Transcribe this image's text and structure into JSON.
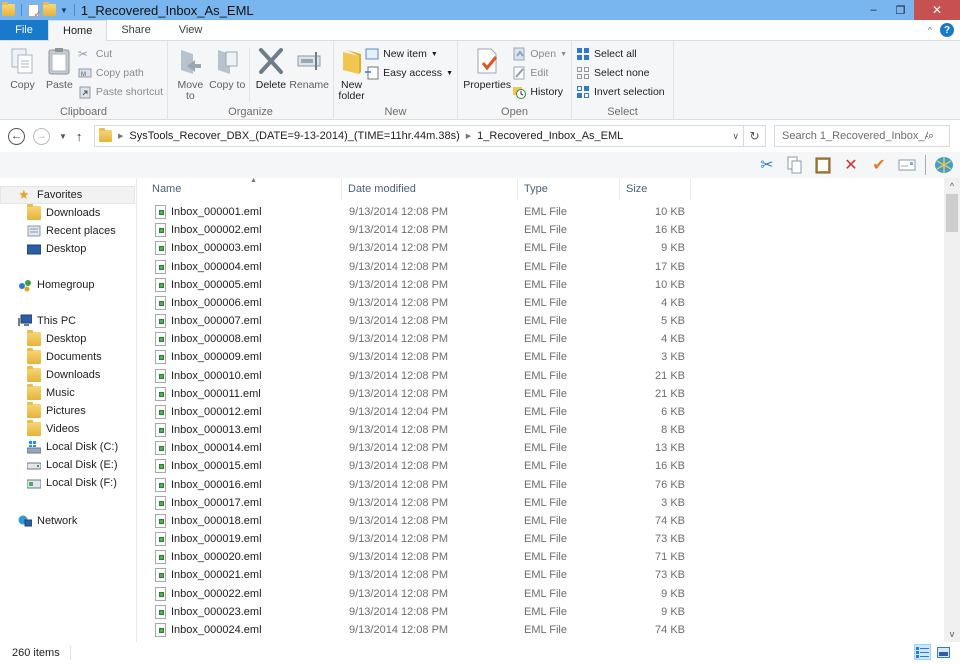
{
  "window": {
    "title": "1_Recovered_Inbox_As_EML",
    "minimize": "–",
    "restore": "❐",
    "close": "✕"
  },
  "ribbon_tabs": [
    {
      "label": "File"
    },
    {
      "label": "Home"
    },
    {
      "label": "Share"
    },
    {
      "label": "View"
    }
  ],
  "ribbon": {
    "clipboard": {
      "label": "Clipboard",
      "copy": "Copy",
      "paste": "Paste",
      "cut": "Cut",
      "copy_path": "Copy path",
      "paste_shortcut": "Paste shortcut"
    },
    "organize": {
      "label": "Organize",
      "move_to": "Move to",
      "copy_to": "Copy to",
      "delete": "Delete",
      "rename": "Rename"
    },
    "new": {
      "label": "New",
      "new_folder": "New folder",
      "new_item": "New item",
      "easy_access": "Easy access"
    },
    "open": {
      "label": "Open",
      "properties": "Properties",
      "open": "Open",
      "edit": "Edit",
      "history": "History"
    },
    "select": {
      "label": "Select",
      "select_all": "Select all",
      "select_none": "Select none",
      "invert_selection": "Invert selection"
    }
  },
  "address": {
    "crumbs": [
      "SysTools_Recover_DBX_(DATE=9-13-2014)_(TIME=11hr.44m.38s)",
      "1_Recovered_Inbox_As_EML"
    ],
    "search_placeholder": "Search 1_Recovered_Inbox_As..."
  },
  "sidebar": {
    "favorites": "Favorites",
    "favorites_items": [
      "Downloads",
      "Recent places",
      "Desktop"
    ],
    "homegroup": "Homegroup",
    "this_pc": "This PC",
    "this_pc_items": [
      "Desktop",
      "Documents",
      "Downloads",
      "Music",
      "Pictures",
      "Videos",
      "Local Disk (C:)",
      "Local Disk (E:)",
      "Local Disk (F:)"
    ],
    "network": "Network"
  },
  "columns": {
    "name": "Name",
    "date": "Date modified",
    "type": "Type",
    "size": "Size"
  },
  "files": [
    {
      "name": "Inbox_000001.eml",
      "date": "9/13/2014 12:08 PM",
      "type": "EML File",
      "size": "10 KB"
    },
    {
      "name": "Inbox_000002.eml",
      "date": "9/13/2014 12:08 PM",
      "type": "EML File",
      "size": "16 KB"
    },
    {
      "name": "Inbox_000003.eml",
      "date": "9/13/2014 12:08 PM",
      "type": "EML File",
      "size": "9 KB"
    },
    {
      "name": "Inbox_000004.eml",
      "date": "9/13/2014 12:08 PM",
      "type": "EML File",
      "size": "17 KB"
    },
    {
      "name": "Inbox_000005.eml",
      "date": "9/13/2014 12:08 PM",
      "type": "EML File",
      "size": "10 KB"
    },
    {
      "name": "Inbox_000006.eml",
      "date": "9/13/2014 12:08 PM",
      "type": "EML File",
      "size": "4 KB"
    },
    {
      "name": "Inbox_000007.eml",
      "date": "9/13/2014 12:08 PM",
      "type": "EML File",
      "size": "5 KB"
    },
    {
      "name": "Inbox_000008.eml",
      "date": "9/13/2014 12:08 PM",
      "type": "EML File",
      "size": "4 KB"
    },
    {
      "name": "Inbox_000009.eml",
      "date": "9/13/2014 12:08 PM",
      "type": "EML File",
      "size": "3 KB"
    },
    {
      "name": "Inbox_000010.eml",
      "date": "9/13/2014 12:08 PM",
      "type": "EML File",
      "size": "21 KB"
    },
    {
      "name": "Inbox_000011.eml",
      "date": "9/13/2014 12:08 PM",
      "type": "EML File",
      "size": "21 KB"
    },
    {
      "name": "Inbox_000012.eml",
      "date": "9/13/2014 12:04 PM",
      "type": "EML File",
      "size": "6 KB"
    },
    {
      "name": "Inbox_000013.eml",
      "date": "9/13/2014 12:08 PM",
      "type": "EML File",
      "size": "8 KB"
    },
    {
      "name": "Inbox_000014.eml",
      "date": "9/13/2014 12:08 PM",
      "type": "EML File",
      "size": "13 KB"
    },
    {
      "name": "Inbox_000015.eml",
      "date": "9/13/2014 12:08 PM",
      "type": "EML File",
      "size": "16 KB"
    },
    {
      "name": "Inbox_000016.eml",
      "date": "9/13/2014 12:08 PM",
      "type": "EML File",
      "size": "76 KB"
    },
    {
      "name": "Inbox_000017.eml",
      "date": "9/13/2014 12:08 PM",
      "type": "EML File",
      "size": "3 KB"
    },
    {
      "name": "Inbox_000018.eml",
      "date": "9/13/2014 12:08 PM",
      "type": "EML File",
      "size": "74 KB"
    },
    {
      "name": "Inbox_000019.eml",
      "date": "9/13/2014 12:08 PM",
      "type": "EML File",
      "size": "73 KB"
    },
    {
      "name": "Inbox_000020.eml",
      "date": "9/13/2014 12:08 PM",
      "type": "EML File",
      "size": "71 KB"
    },
    {
      "name": "Inbox_000021.eml",
      "date": "9/13/2014 12:08 PM",
      "type": "EML File",
      "size": "73 KB"
    },
    {
      "name": "Inbox_000022.eml",
      "date": "9/13/2014 12:08 PM",
      "type": "EML File",
      "size": "9 KB"
    },
    {
      "name": "Inbox_000023.eml",
      "date": "9/13/2014 12:08 PM",
      "type": "EML File",
      "size": "9 KB"
    },
    {
      "name": "Inbox_000024.eml",
      "date": "9/13/2014 12:08 PM",
      "type": "EML File",
      "size": "74 KB"
    }
  ],
  "status": {
    "item_count": "260 items"
  },
  "colors": {
    "titlebar": "#79b5ee",
    "file_tab": "#1979ca",
    "close_button": "#c75050",
    "ribbon_bg": "#f5f6f7"
  }
}
